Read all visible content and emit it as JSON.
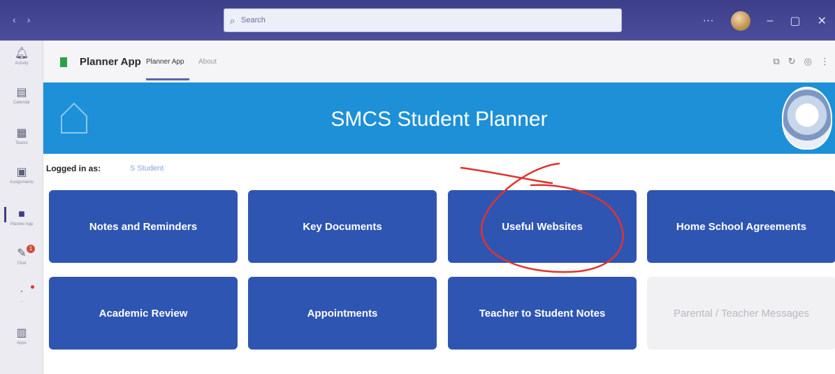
{
  "titlebar": {
    "search_placeholder": "Search",
    "nav_back": "‹",
    "nav_forward": "›"
  },
  "rail": [
    {
      "label": "Activity",
      "icon": "bell-icon"
    },
    {
      "label": "Calendar",
      "icon": "calendar-icon"
    },
    {
      "label": "Teams",
      "icon": "teams-icon"
    },
    {
      "label": "Assignments",
      "icon": "assignments-icon"
    },
    {
      "label": "Planner App",
      "icon": "planner-icon"
    },
    {
      "label": "Chat",
      "icon": "chat-icon",
      "badge": "1"
    },
    {
      "label": "...",
      "icon": "more-icon"
    },
    {
      "label": "Apps",
      "icon": "apps-icon"
    }
  ],
  "app": {
    "name": "Planner App",
    "tabs": [
      "Planner App",
      "About"
    ]
  },
  "banner": {
    "title": "SMCS Student Planner"
  },
  "logged_in": {
    "label": "Logged in as:",
    "user": "S Student"
  },
  "tiles": [
    {
      "label": "Notes and Reminders",
      "enabled": true
    },
    {
      "label": "Key Documents",
      "enabled": true
    },
    {
      "label": "Useful Websites",
      "enabled": true
    },
    {
      "label": "Home School Agreements",
      "enabled": true
    },
    {
      "label": "Academic Review",
      "enabled": true
    },
    {
      "label": "Appointments",
      "enabled": true
    },
    {
      "label": "Teacher to Student Notes",
      "enabled": true
    },
    {
      "label": "Parental / Teacher Messages",
      "enabled": false
    }
  ],
  "colors": {
    "titlebar": "#3d3f8a",
    "banner": "#1d90d8",
    "tile": "#2f55b3",
    "annotation": "#e0332d"
  }
}
